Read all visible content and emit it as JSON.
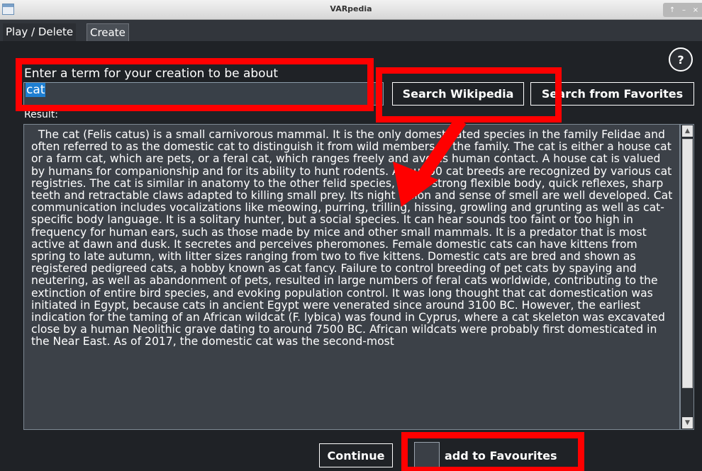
{
  "window": {
    "title": "VARpedia"
  },
  "tabs": [
    {
      "label": "Play / Delete"
    },
    {
      "label": "Create"
    }
  ],
  "help": {
    "label": "?"
  },
  "term": {
    "label": "Enter a term for your creation to be about",
    "value": "cat"
  },
  "buttons": {
    "search_wikipedia": "Search Wikipedia",
    "search_favorites": "Search from Favorites",
    "continue": "Continue"
  },
  "result": {
    "label": "Result:",
    "text": "  The cat (Felis catus) is a small carnivorous mammal. It is the only domesticated species in the family Felidae and often referred to as the domestic cat to distinguish it from wild members of the family. The cat is either a house cat or a farm cat, which are pets, or a feral cat, which ranges freely and avoids human contact. A house cat is valued by humans for companionship and for its ability to hunt rodents. About 60 cat breeds are recognized by various cat registries. The cat is similar in anatomy to the other felid species, has a strong flexible body, quick reflexes, sharp teeth and retractable claws adapted to killing small prey. Its night vision and sense of smell are well developed. Cat communication includes vocalizations like meowing, purring, trilling, hissing, growling and grunting as well as cat-specific body language. It is a solitary hunter, but a social species. It can hear sounds too faint or too high in frequency for human ears, such as those made by mice and other small mammals. It is a predator that is most active at dawn and dusk. It secretes and perceives pheromones. Female domestic cats can have kittens from spring to late autumn, with litter sizes ranging from two to five kittens. Domestic cats are bred and shown as registered pedigreed cats, a hobby known as cat fancy. Failure to control breeding of pet cats by spaying and neutering, as well as abandonment of pets, resulted in large numbers of feral cats worldwide, contributing to the extinction of entire bird species, and evoking population control. It was long thought that cat domestication was initiated in Egypt, because cats in ancient Egypt were venerated since around 3100 BC. However, the earliest indication for the taming of an African wildcat (F. lybica) was found in Cyprus, where a cat skeleton was excavated close by a human Neolithic grave dating to around 7500 BC. African wildcats were probably first domesticated in the Near East. As of 2017, the domestic cat was the second-most"
  },
  "favourites": {
    "label": "add to Favourites",
    "checked": false
  },
  "colors": {
    "annotation": "#ff0000",
    "background": "#1f2226",
    "selection": "#1f7fd1"
  }
}
